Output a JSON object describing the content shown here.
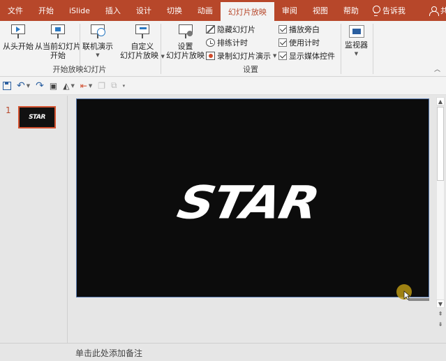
{
  "tabs": [
    {
      "label": "文件",
      "active": false
    },
    {
      "label": "开始",
      "active": false
    },
    {
      "label": "iSlide",
      "active": false
    },
    {
      "label": "插入",
      "active": false
    },
    {
      "label": "设计",
      "active": false
    },
    {
      "label": "切换",
      "active": false
    },
    {
      "label": "动画",
      "active": false
    },
    {
      "label": "幻灯片放映",
      "active": true
    },
    {
      "label": "审阅",
      "active": false
    },
    {
      "label": "视图",
      "active": false
    },
    {
      "label": "帮助",
      "active": false
    }
  ],
  "tell_me": "告诉我",
  "share": "共享",
  "ribbon": {
    "start_group": {
      "label": "开始放映幻灯片",
      "from_beginning": "从头开始",
      "from_current_line1": "从当前幻灯片",
      "from_current_line2": "开始",
      "online_present": "联机演示",
      "custom_line1": "自定义",
      "custom_line2": "幻灯片放映"
    },
    "setup_group": {
      "label": "设置",
      "setup_line1": "设置",
      "setup_line2": "幻灯片放映",
      "hide_slide": "隐藏幻灯片",
      "rehearse": "排练计时",
      "record": "录制幻灯片演示",
      "play_narrations": "播放旁白",
      "use_timings": "使用计时",
      "show_media_controls": "显示媒体控件"
    },
    "monitor_group": {
      "monitor": "监视器"
    }
  },
  "slides": [
    {
      "number": "1",
      "thumb_text": "STAR"
    }
  ],
  "slide_text": "STAR",
  "notes_placeholder": "单击此处添加备注",
  "colors": {
    "accent": "#b7472a",
    "slide_bg": "#0c0c0c"
  }
}
